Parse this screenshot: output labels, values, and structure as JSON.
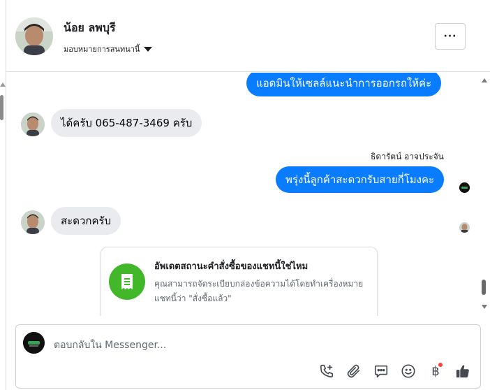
{
  "header": {
    "contact_name": "น้อย ลพบุรี",
    "assign_label": "มอบหมายการสนทนานี้",
    "more_label": "···"
  },
  "messages": {
    "m1": "แอดมินให้เซลล์แนะนำการออกรถให้ค่ะ",
    "m2": "ได้ครับ 065-487-3469 ครับ",
    "sender_name": "ธิดารัตน์ อาจประจัน",
    "m3": "พรุ่งนี้ลูกค้าสะดวกรับสายกี่โมงคะ",
    "m4": "สะดวกครับ"
  },
  "card": {
    "title": "อัพเดตสถานะคำสั่งซื้อของแชทนี้ใช่ไหม",
    "description": "คุณสามารถจัดระเบียบกล่องข้อความได้โดยทำเครื่องหมายแชทนี้ว่า \"สั่งซื้อแล้ว\"",
    "icon": "receipt-icon",
    "icon_color": "#42b72a"
  },
  "composer": {
    "placeholder": "ตอบกลับใน Messenger...",
    "value": "",
    "tools": [
      "phone-plus-icon",
      "paperclip-icon",
      "chat-reply-icon",
      "emoji-icon",
      "baht-payment-icon",
      "thumbs-up-icon"
    ],
    "baht_symbol": "฿"
  },
  "colors": {
    "outgoing_bubble": "#0a7cff",
    "incoming_bubble": "#e9ebee",
    "like_button": "#444950"
  }
}
